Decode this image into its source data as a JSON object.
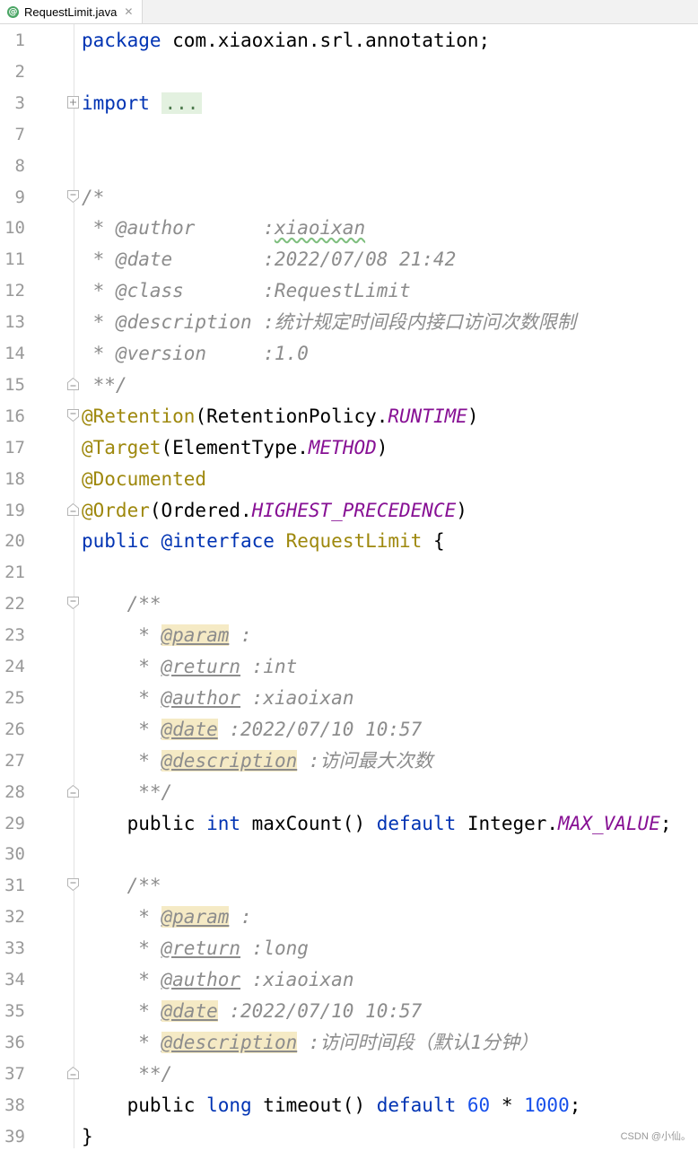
{
  "tab": {
    "icon": "@",
    "title": "RequestLimit.java",
    "close": "✕"
  },
  "lines": [
    {
      "n": "1",
      "fold": "",
      "code": [
        {
          "t": "package",
          "c": "kw"
        },
        {
          "t": " com.xiaoxian.srl.annotation;",
          "c": ""
        }
      ]
    },
    {
      "n": "2",
      "fold": "",
      "code": []
    },
    {
      "n": "3",
      "fold": "plus",
      "code": [
        {
          "t": "import",
          "c": "kw"
        },
        {
          "t": " ",
          "c": ""
        },
        {
          "t": "...",
          "c": "fold-dots"
        }
      ]
    },
    {
      "n": "7",
      "fold": "",
      "code": []
    },
    {
      "n": "8",
      "fold": "",
      "code": []
    },
    {
      "n": "9",
      "fold": "open",
      "code": [
        {
          "t": "/*",
          "c": "cmt"
        }
      ]
    },
    {
      "n": "10",
      "fold": "",
      "code": [
        {
          "t": " * @author      :",
          "c": "cmt"
        },
        {
          "t": "xiaoixan",
          "c": "cmt typo"
        }
      ]
    },
    {
      "n": "11",
      "fold": "",
      "code": [
        {
          "t": " * @date        :2022/07/08 21:42",
          "c": "cmt"
        }
      ]
    },
    {
      "n": "12",
      "fold": "",
      "code": [
        {
          "t": " * @class       :RequestLimit",
          "c": "cmt"
        }
      ]
    },
    {
      "n": "13",
      "fold": "",
      "code": [
        {
          "t": " * @description :统计规定时间段内接口访问次数限制",
          "c": "cmt"
        }
      ]
    },
    {
      "n": "14",
      "fold": "",
      "code": [
        {
          "t": " * @version     :1.0",
          "c": "cmt"
        }
      ]
    },
    {
      "n": "15",
      "fold": "close",
      "code": [
        {
          "t": " **/",
          "c": "cmt"
        }
      ]
    },
    {
      "n": "16",
      "fold": "open",
      "code": [
        {
          "t": "@Retention",
          "c": "ann"
        },
        {
          "t": "(RetentionPolicy.",
          "c": ""
        },
        {
          "t": "RUNTIME",
          "c": "const"
        },
        {
          "t": ")",
          "c": ""
        }
      ]
    },
    {
      "n": "17",
      "fold": "",
      "code": [
        {
          "t": "@Target",
          "c": "ann"
        },
        {
          "t": "(ElementType.",
          "c": ""
        },
        {
          "t": "METHOD",
          "c": "const"
        },
        {
          "t": ")",
          "c": ""
        }
      ]
    },
    {
      "n": "18",
      "fold": "",
      "code": [
        {
          "t": "@Documented",
          "c": "ann"
        }
      ]
    },
    {
      "n": "19",
      "fold": "close",
      "code": [
        {
          "t": "@Order",
          "c": "ann"
        },
        {
          "t": "(Ordered.",
          "c": ""
        },
        {
          "t": "HIGHEST_PRECEDENCE",
          "c": "const"
        },
        {
          "t": ")",
          "c": ""
        }
      ]
    },
    {
      "n": "20",
      "fold": "",
      "code": [
        {
          "t": "public",
          "c": "kw"
        },
        {
          "t": " ",
          "c": ""
        },
        {
          "t": "@interface",
          "c": "kw"
        },
        {
          "t": " ",
          "c": ""
        },
        {
          "t": "RequestLimit",
          "c": "ann"
        },
        {
          "t": " {",
          "c": ""
        }
      ]
    },
    {
      "n": "21",
      "fold": "",
      "code": []
    },
    {
      "n": "22",
      "fold": "open",
      "code": [
        {
          "t": "    /**",
          "c": "cmt"
        }
      ]
    },
    {
      "n": "23",
      "fold": "",
      "code": [
        {
          "t": "     * ",
          "c": "cmt"
        },
        {
          "t": "@param",
          "c": "tag tag-hl"
        },
        {
          "t": " :",
          "c": "cmt"
        }
      ]
    },
    {
      "n": "24",
      "fold": "",
      "code": [
        {
          "t": "     * ",
          "c": "cmt"
        },
        {
          "t": "@return",
          "c": "tag"
        },
        {
          "t": " :int",
          "c": "cmt"
        }
      ]
    },
    {
      "n": "25",
      "fold": "",
      "code": [
        {
          "t": "     * ",
          "c": "cmt"
        },
        {
          "t": "@author",
          "c": "tag"
        },
        {
          "t": " :xiaoixan",
          "c": "cmt"
        }
      ]
    },
    {
      "n": "26",
      "fold": "",
      "code": [
        {
          "t": "     * ",
          "c": "cmt"
        },
        {
          "t": "@date",
          "c": "tag tag-hl"
        },
        {
          "t": " :2022/07/10 10:57",
          "c": "cmt"
        }
      ]
    },
    {
      "n": "27",
      "fold": "",
      "code": [
        {
          "t": "     * ",
          "c": "cmt"
        },
        {
          "t": "@description",
          "c": "tag tag-hl"
        },
        {
          "t": " :访问最大次数",
          "c": "cmt"
        }
      ]
    },
    {
      "n": "28",
      "fold": "close",
      "code": [
        {
          "t": "     **/",
          "c": "cmt"
        }
      ]
    },
    {
      "n": "29",
      "fold": "",
      "code": [
        {
          "t": "    public ",
          "c": ""
        },
        {
          "t": "int",
          "c": "kw"
        },
        {
          "t": " maxCount() ",
          "c": ""
        },
        {
          "t": "default",
          "c": "kw"
        },
        {
          "t": " Integer.",
          "c": ""
        },
        {
          "t": "MAX_VALUE",
          "c": "const"
        },
        {
          "t": ";",
          "c": ""
        }
      ]
    },
    {
      "n": "30",
      "fold": "",
      "code": []
    },
    {
      "n": "31",
      "fold": "open",
      "code": [
        {
          "t": "    /**",
          "c": "cmt"
        }
      ]
    },
    {
      "n": "32",
      "fold": "",
      "code": [
        {
          "t": "     * ",
          "c": "cmt"
        },
        {
          "t": "@param",
          "c": "tag tag-hl"
        },
        {
          "t": " :",
          "c": "cmt"
        }
      ]
    },
    {
      "n": "33",
      "fold": "",
      "code": [
        {
          "t": "     * ",
          "c": "cmt"
        },
        {
          "t": "@return",
          "c": "tag"
        },
        {
          "t": " :long",
          "c": "cmt"
        }
      ]
    },
    {
      "n": "34",
      "fold": "",
      "code": [
        {
          "t": "     * ",
          "c": "cmt"
        },
        {
          "t": "@author",
          "c": "tag"
        },
        {
          "t": " :xiaoixan",
          "c": "cmt"
        }
      ]
    },
    {
      "n": "35",
      "fold": "",
      "code": [
        {
          "t": "     * ",
          "c": "cmt"
        },
        {
          "t": "@date",
          "c": "tag tag-hl"
        },
        {
          "t": " :2022/07/10 10:57",
          "c": "cmt"
        }
      ]
    },
    {
      "n": "36",
      "fold": "",
      "code": [
        {
          "t": "     * ",
          "c": "cmt"
        },
        {
          "t": "@description",
          "c": "tag tag-hl"
        },
        {
          "t": " :访问时间段（默认1分钟）",
          "c": "cmt"
        }
      ]
    },
    {
      "n": "37",
      "fold": "close",
      "code": [
        {
          "t": "     **/",
          "c": "cmt"
        }
      ]
    },
    {
      "n": "38",
      "fold": "",
      "code": [
        {
          "t": "    public ",
          "c": ""
        },
        {
          "t": "long",
          "c": "kw"
        },
        {
          "t": " timeout() ",
          "c": ""
        },
        {
          "t": "default",
          "c": "kw"
        },
        {
          "t": " ",
          "c": ""
        },
        {
          "t": "60",
          "c": "num"
        },
        {
          "t": " * ",
          "c": ""
        },
        {
          "t": "1000",
          "c": "num"
        },
        {
          "t": ";",
          "c": ""
        }
      ]
    },
    {
      "n": "39",
      "fold": "",
      "code": [
        {
          "t": "}",
          "c": ""
        }
      ]
    }
  ],
  "watermark": "CSDN @小仙。"
}
